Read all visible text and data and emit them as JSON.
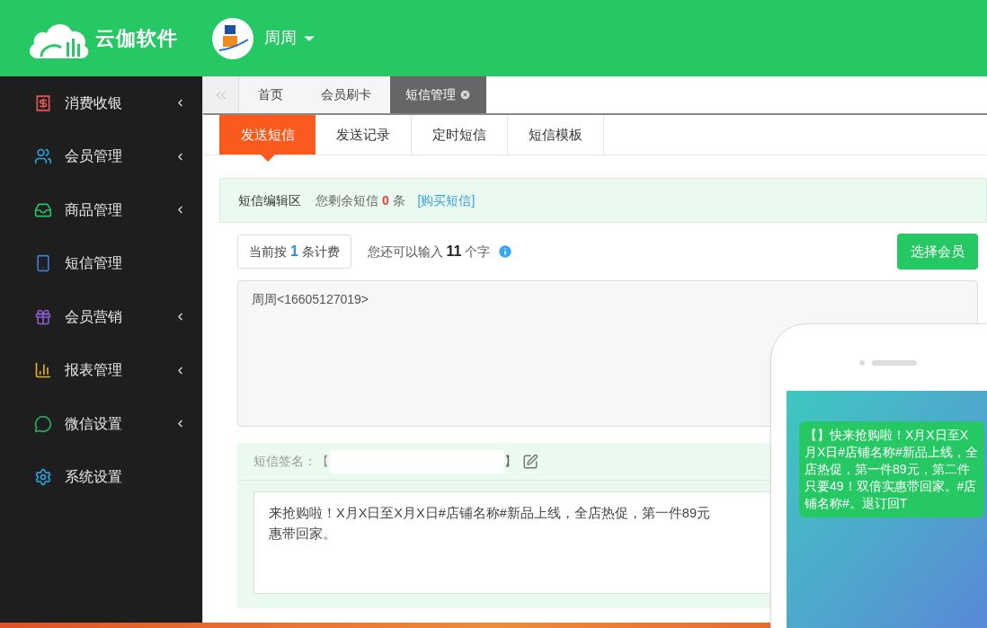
{
  "header": {
    "brand": "云伽软件",
    "user": "周周"
  },
  "sidebar": {
    "items": [
      {
        "label": "消费收银",
        "color": "#e0584f",
        "has_submenu": true
      },
      {
        "label": "会员管理",
        "color": "#2aa4e0",
        "has_submenu": true
      },
      {
        "label": "商品管理",
        "color": "#27c264",
        "has_submenu": true
      },
      {
        "label": "短信管理",
        "color": "#3a7fd8",
        "has_submenu": false
      },
      {
        "label": "会员营销",
        "color": "#8a5cd0",
        "has_submenu": true
      },
      {
        "label": "报表管理",
        "color": "#e0b030",
        "has_submenu": true
      },
      {
        "label": "微信设置",
        "color": "#27b05a",
        "has_submenu": true
      },
      {
        "label": "系统设置",
        "color": "#2aa4e0",
        "has_submenu": false
      }
    ]
  },
  "page_tabs": [
    {
      "label": "首页",
      "selected": false
    },
    {
      "label": "会员刷卡",
      "selected": false
    },
    {
      "label": "短信管理",
      "selected": true
    }
  ],
  "sub_tabs": [
    {
      "label": "发送短信",
      "selected": true
    },
    {
      "label": "发送记录",
      "selected": false
    },
    {
      "label": "定时短信",
      "selected": false
    },
    {
      "label": "短信模板",
      "selected": false
    }
  ],
  "editor": {
    "title": "短信编辑区",
    "remaining_prefix": "您剩余短信",
    "remaining_count": "0",
    "remaining_suffix": "条",
    "buy_link": "[购买短信]",
    "billing_prefix": "当前按",
    "billing_count": "1",
    "billing_suffix": "条计费",
    "input_prefix": "您还可以输入",
    "input_count": "11",
    "input_suffix": "个字",
    "select_button": "选择会员",
    "recipients": "周周<16605127019>"
  },
  "signature": {
    "label": "短信签名：【",
    "close_bracket": "】",
    "message_lines": [
      "来抢购啦！X月X日至X月X日#店铺名称#新品上线，全店热促，第一件89元",
      "惠带回家。"
    ]
  },
  "phone_preview": {
    "bubble": "【】快来抢购啦！X月X日至X月X日#店铺名称#新品上线，全店热促，第一件89元，第二件只要49！双倍实惠带回家。#店铺名称#。退订回T"
  }
}
